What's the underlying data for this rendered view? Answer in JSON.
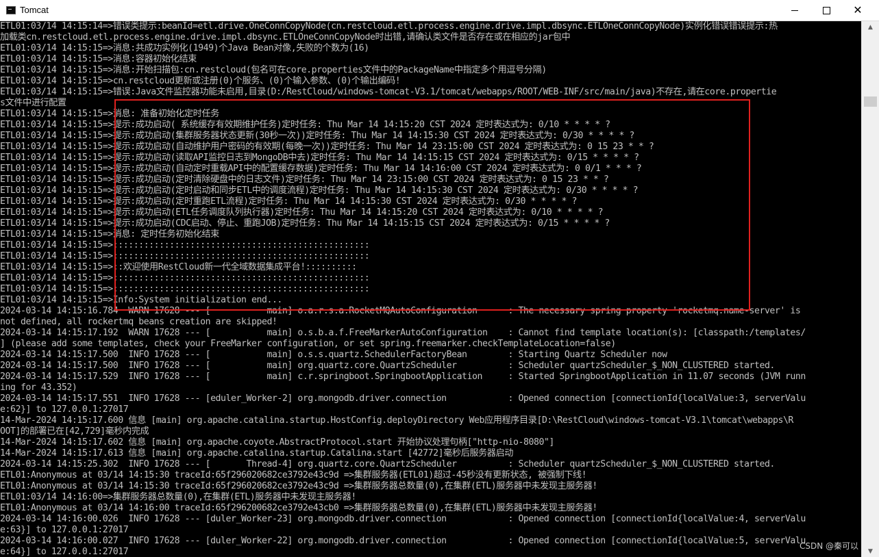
{
  "window": {
    "title": "Tomcat",
    "min_label": "",
    "max_label": "",
    "close_label": "✕"
  },
  "console_lines": [
    "ETL01:03/14 14:15:14=>错误类提示:beanId=etl.drive.OneConnCopyNode(cn.restcloud.etl.process.engine.drive.impl.dbsync.ETLOneConnCopyNode)实例化错误错误提示:热",
    "加载类cn.restcloud.etl.process.engine.drive.impl.dbsync.ETLOneConnCopyNode时出错,请确认类文件是否存在或在相应的jar包中",
    "ETL01:03/14 14:15:15=>消息:共成功实例化(1949)个Java Bean对像,失败的个数为(16)",
    "ETL01:03/14 14:15:15=>消息:容器初始化结束",
    "ETL01:03/14 14:15:15=>消息:开始扫描包:cn.restcloud(包名可在core.properties文件中的PackageName中指定多个用逗号分隔)",
    "ETL01:03/14 14:15:15=>cn.restcloud更新或注册(0)个服务、(0)个输入参数、(0)个输出编码!",
    "ETL01:03/14 14:15:15=>错误:Java文件监控器功能未启用,目录(D:/RestCloud/windows-tomcat-V3.1/tomcat/webapps/ROOT/WEB-INF/src/main/java)不存在,请在core.propertie",
    "s文件中进行配置",
    "ETL01:03/14 14:15:15=>消息: 准备初始化定时任务",
    "ETL01:03/14 14:15:15=>提示:成功启动( 系统缓存有效期维护任务)定时任务: Thu Mar 14 14:15:20 CST 2024 定时表达式为: 0/10 * * * * ?",
    "ETL01:03/14 14:15:15=>提示:成功启动(集群服务器状态更新(30秒一次))定时任务: Thu Mar 14 14:15:30 CST 2024 定时表达式为: 0/30 * * * * ?",
    "ETL01:03/14 14:15:15=>提示:成功启动(自动维护用户密码的有效期(每晚一次))定时任务: Thu Mar 14 23:15:00 CST 2024 定时表达式为: 0 15 23 * * ?",
    "ETL01:03/14 14:15:15=>提示:成功启动(读取API监控日志到MongoDB中去)定时任务: Thu Mar 14 14:15:15 CST 2024 定时表达式为: 0/15 * * * * ?",
    "ETL01:03/14 14:15:15=>提示:成功启动(自动定时重载API中的配置缓存数据)定时任务: Thu Mar 14 14:16:00 CST 2024 定时表达式为: 0 0/1 * * * ?",
    "ETL01:03/14 14:15:15=>提示:成功启动(定时清除硬盘中的日志文件)定时任务: Thu Mar 14 23:15:00 CST 2024 定时表达式为: 0 15 23 * * ?",
    "ETL01:03/14 14:15:15=>提示:成功启动(定时启动和同步ETL中的调度流程)定时任务: Thu Mar 14 14:15:30 CST 2024 定时表达式为: 0/30 * * * * ?",
    "ETL01:03/14 14:15:15=>提示:成功启动(定时重跑ETL流程)定时任务: Thu Mar 14 14:15:30 CST 2024 定时表达式为: 0/30 * * * * ?",
    "ETL01:03/14 14:15:15=>提示:成功启动(ETL任务调度队列执行器)定时任务: Thu Mar 14 14:15:20 CST 2024 定时表达式为: 0/10 * * * * ?",
    "ETL01:03/14 14:15:15=>提示:成功启动(CDC启动、停止、重跑JOB)定时任务: Thu Mar 14 14:15:15 CST 2024 定时表达式为: 0/15 * * * * ?",
    "ETL01:03/14 14:15:15=>消息: 定时任务初始化结束",
    "ETL01:03/14 14:15:15=>::::::::::::::::::::::::::::::::::::::::::::::::::",
    "ETL01:03/14 14:15:15=>::::::::::::::::::::::::::::::::::::::::::::::::::",
    "ETL01:03/14 14:15:15=>::欢迎使用RestCloud新一代全域数据集成平台!::::::::::",
    "ETL01:03/14 14:15:15=>::::::::::::::::::::::::::::::::::::::::::::::::::",
    "ETL01:03/14 14:15:15=>::::::::::::::::::::::::::::::::::::::::::::::::::",
    "ETL01:03/14 14:15:15=>Info:System initialization end...",
    "2024-03-14 14:15:16.784  WARN 17628 --- [           main] o.a.r.s.a.RocketMQAutoConfiguration      : The necessary spring property 'rocketmq.name-server' is",
    "not defined, all rockertmq beans creation are skipped!",
    "2024-03-14 14:15:17.192  WARN 17628 --- [           main] o.s.b.a.f.FreeMarkerAutoConfiguration    : Cannot find template location(s): [classpath:/templates/",
    "] (please add some templates, check your FreeMarker configuration, or set spring.freemarker.checkTemplateLocation=false)",
    "2024-03-14 14:15:17.500  INFO 17628 --- [           main] o.s.s.quartz.SchedulerFactoryBean        : Starting Quartz Scheduler now",
    "2024-03-14 14:15:17.500  INFO 17628 --- [           main] org.quartz.core.QuartzScheduler          : Scheduler quartzScheduler_$_NON_CLUSTERED started.",
    "2024-03-14 14:15:17.529  INFO 17628 --- [           main] c.r.springboot.SpringbootApplication     : Started SpringbootApplication in 11.07 seconds (JVM runn",
    "ing for 43.352)",
    "2024-03-14 14:15:17.551  INFO 17628 --- [eduler_Worker-2] org.mongodb.driver.connection            : Opened connection [connectionId{localValue:3, serverValu",
    "e:62}] to 127.0.0.1:27017",
    "14-Mar-2024 14:15:17.600 信息 [main] org.apache.catalina.startup.HostConfig.deployDirectory Web应用程序目录[D:\\RestCloud\\windows-tomcat-V3.1\\tomcat\\webapps\\R",
    "OOT]的部署已在[42,729]毫秒内完成",
    "14-Mar-2024 14:15:17.602 信息 [main] org.apache.coyote.AbstractProtocol.start 开始协议处理句柄[\"http-nio-8080\"]",
    "14-Mar-2024 14:15:17.613 信息 [main] org.apache.catalina.startup.Catalina.start [42772]毫秒后服务器启动",
    "2024-03-14 14:15:25.302  INFO 17628 --- [       Thread-4] org.quartz.core.QuartzScheduler          : Scheduler quartzScheduler_$_NON_CLUSTERED started.",
    "ETL01:Anonymous at 03/14 14:15:30 traceId:65f296020682ce3792e43c9d =>集群服务器(ETL01)超过-45秒没有更新状态, 被强制下线!",
    "ETL01:Anonymous at 03/14 14:15:30 traceId:65f296020682ce3792e43c9d =>集群服务器总数量(0),在集群(ETL)服务器中未发现主服务器!",
    "ETL01:03/14 14:16:00=>集群服务器总数量(0),在集群(ETL)服务器中未发现主服务器!",
    "ETL01:Anonymous at 03/14 14:16:00 traceId:65f296200682ce3792e43cb0 =>集群服务器总数量(0),在集群(ETL)服务器中未发现主服务器!",
    "2024-03-14 14:16:00.026  INFO 17628 --- [duler_Worker-23] org.mongodb.driver.connection            : Opened connection [connectionId{localValue:4, serverValu",
    "e:63}] to 127.0.0.1:27017",
    "2024-03-14 14:16:00.027  INFO 17628 --- [duler_Worker-22] org.mongodb.driver.connection            : Opened connection [connectionId{localValue:5, serverValu",
    "e:64}] to 127.0.0.1:27017"
  ],
  "watermark": "CSDN @秦可以"
}
